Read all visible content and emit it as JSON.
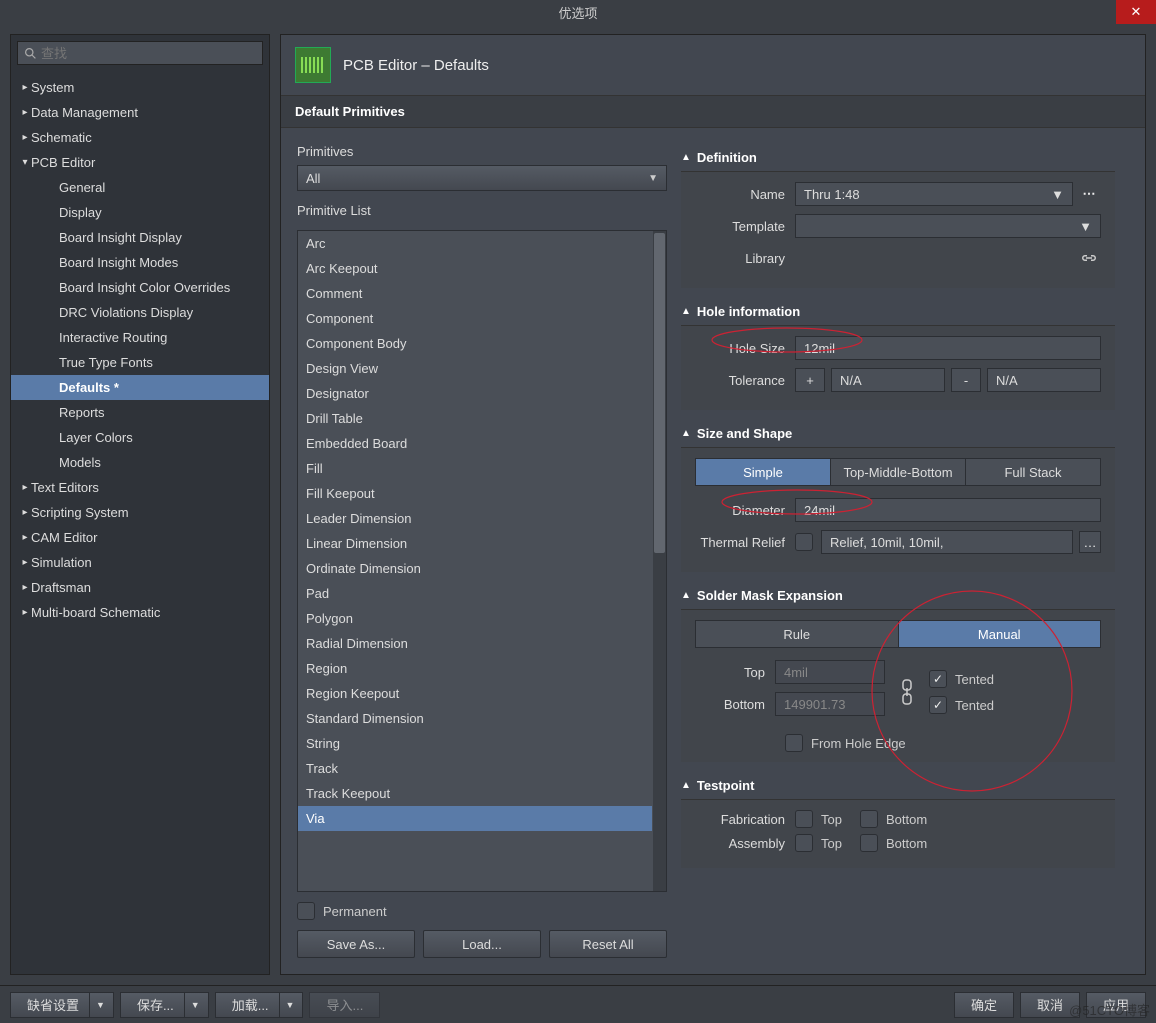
{
  "window": {
    "title": "优选项",
    "close": "✕"
  },
  "search": {
    "placeholder": "查找"
  },
  "tree": [
    {
      "label": "System",
      "caret": "▸",
      "child": false
    },
    {
      "label": "Data Management",
      "caret": "▸",
      "child": false
    },
    {
      "label": "Schematic",
      "caret": "▸",
      "child": false
    },
    {
      "label": "PCB Editor",
      "caret": "▾",
      "child": false
    },
    {
      "label": "General",
      "caret": "",
      "child": true
    },
    {
      "label": "Display",
      "caret": "",
      "child": true
    },
    {
      "label": "Board Insight Display",
      "caret": "",
      "child": true
    },
    {
      "label": "Board Insight Modes",
      "caret": "",
      "child": true
    },
    {
      "label": "Board Insight Color Overrides",
      "caret": "",
      "child": true
    },
    {
      "label": "DRC Violations Display",
      "caret": "",
      "child": true
    },
    {
      "label": "Interactive Routing",
      "caret": "",
      "child": true
    },
    {
      "label": "True Type Fonts",
      "caret": "",
      "child": true
    },
    {
      "label": "Defaults *",
      "caret": "",
      "child": true,
      "selected": true
    },
    {
      "label": "Reports",
      "caret": "",
      "child": true
    },
    {
      "label": "Layer Colors",
      "caret": "",
      "child": true
    },
    {
      "label": "Models",
      "caret": "",
      "child": true
    },
    {
      "label": "Text Editors",
      "caret": "▸",
      "child": false
    },
    {
      "label": "Scripting System",
      "caret": "▸",
      "child": false
    },
    {
      "label": "CAM Editor",
      "caret": "▸",
      "child": false
    },
    {
      "label": "Simulation",
      "caret": "▸",
      "child": false
    },
    {
      "label": "Draftsman",
      "caret": "▸",
      "child": false
    },
    {
      "label": "Multi-board Schematic",
      "caret": "▸",
      "child": false
    }
  ],
  "page_title": "PCB Editor – Defaults",
  "section_header": "Default Primitives",
  "primitives": {
    "label": "Primitives",
    "value": "All"
  },
  "primitive_list": {
    "label": "Primitive List",
    "items": [
      "Arc",
      "Arc Keepout",
      "Comment",
      "Component",
      "Component Body",
      "Design View",
      "Designator",
      "Drill Table",
      "Embedded Board",
      "Fill",
      "Fill Keepout",
      "Leader Dimension",
      "Linear Dimension",
      "Ordinate Dimension",
      "Pad",
      "Polygon",
      "Radial Dimension",
      "Region",
      "Region Keepout",
      "Standard Dimension",
      "String",
      "Track",
      "Track Keepout",
      "Via"
    ],
    "selected": "Via"
  },
  "permanent_label": "Permanent",
  "buttons": {
    "save_as": "Save As...",
    "load": "Load...",
    "reset_all": "Reset All"
  },
  "definition": {
    "hdr": "Definition",
    "name_lbl": "Name",
    "name_val": "Thru 1:48",
    "template_lbl": "Template",
    "template_val": "",
    "library_lbl": "Library"
  },
  "hole": {
    "hdr": "Hole information",
    "size_lbl": "Hole Size",
    "size_val": "12mil",
    "tol_lbl": "Tolerance",
    "plus": "+",
    "plus_val": "N/A",
    "minus": "-",
    "minus_val": "N/A"
  },
  "sizeshape": {
    "hdr": "Size and Shape",
    "tabs": [
      "Simple",
      "Top-Middle-Bottom",
      "Full Stack"
    ],
    "active": "Simple",
    "dia_lbl": "Diameter",
    "dia_val": "24mil",
    "tr_lbl": "Thermal Relief",
    "tr_val": "Relief, 10mil, 10mil,"
  },
  "mask": {
    "hdr": "Solder Mask Expansion",
    "tabs": [
      "Rule",
      "Manual"
    ],
    "active": "Manual",
    "top_lbl": "Top",
    "top_val": "4mil",
    "bot_lbl": "Bottom",
    "bot_val": "149901.73",
    "tented": "Tented",
    "from_hole": "From Hole Edge",
    "top_tented": true,
    "bot_tented": true,
    "from_hole_checked": false
  },
  "testpoint": {
    "hdr": "Testpoint",
    "fab_lbl": "Fabrication",
    "asm_lbl": "Assembly",
    "top": "Top",
    "bottom": "Bottom"
  },
  "footer": {
    "default": "缺省设置",
    "save": "保存...",
    "load": "加载...",
    "import": "导入...",
    "ok": "确定",
    "cancel": "取消",
    "apply": "应用",
    "watermark": "@51CTO博客"
  }
}
